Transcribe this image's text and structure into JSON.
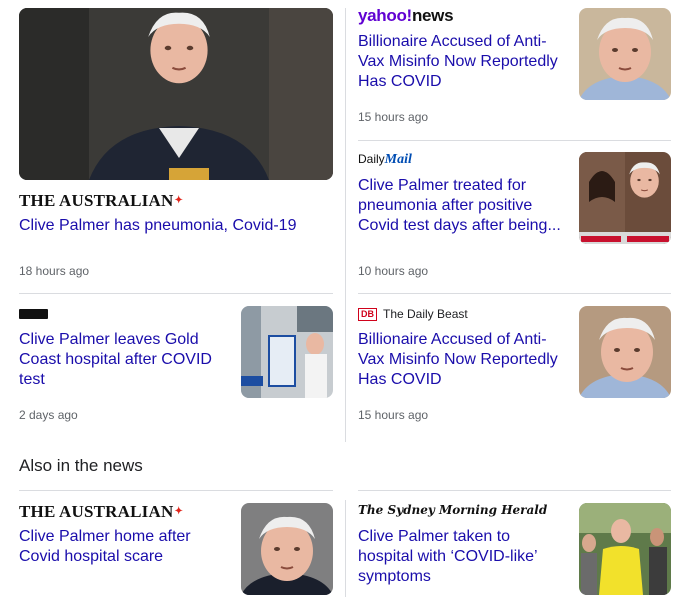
{
  "section": {
    "also_in_news": "Also in the news"
  },
  "cards": [
    {
      "source": "THE AUSTRALIAN",
      "headline": "Clive Palmer has pneumonia, Covid-19",
      "time": "18 hours ago",
      "image": "clive-palmer-photo"
    },
    {
      "source_brand": "yahoo!",
      "source_suffix": "news",
      "headline": "Billionaire Accused of Anti-Vax Misinfo Now Reportedly Has COVID",
      "time": "15 hours ago",
      "image": "clive-palmer-photo"
    },
    {
      "source_brand": "Daily",
      "source_suffix": "Mail",
      "headline": "Clive Palmer treated for pneumonia after positive Covid test days after being...",
      "time": "10 hours ago",
      "image": "clive-palmer-collage"
    },
    {
      "source": "",
      "headline": "Clive Palmer leaves Gold Coast hospital after COVID test",
      "time": "2 days ago",
      "image": "hospital-exit-photo"
    },
    {
      "source_logo": "DB",
      "source": "The Daily Beast",
      "headline": "Billionaire Accused of Anti-Vax Misinfo Now Reportedly Has COVID",
      "time": "15 hours ago",
      "image": "clive-palmer-photo"
    },
    {
      "source": "THE AUSTRALIAN",
      "headline": "Clive Palmer home after Covid hospital scare",
      "image": "clive-palmer-photo"
    },
    {
      "source": "The Sydney Morning Herald",
      "headline": "Clive Palmer taken to hospital with ‘COVID-like’ symptoms",
      "image": "clive-palmer-yellow-shirt-photo"
    }
  ],
  "colors": {
    "headline": "#1a0dab",
    "time": "#5f6368",
    "divider": "#dadce0"
  }
}
